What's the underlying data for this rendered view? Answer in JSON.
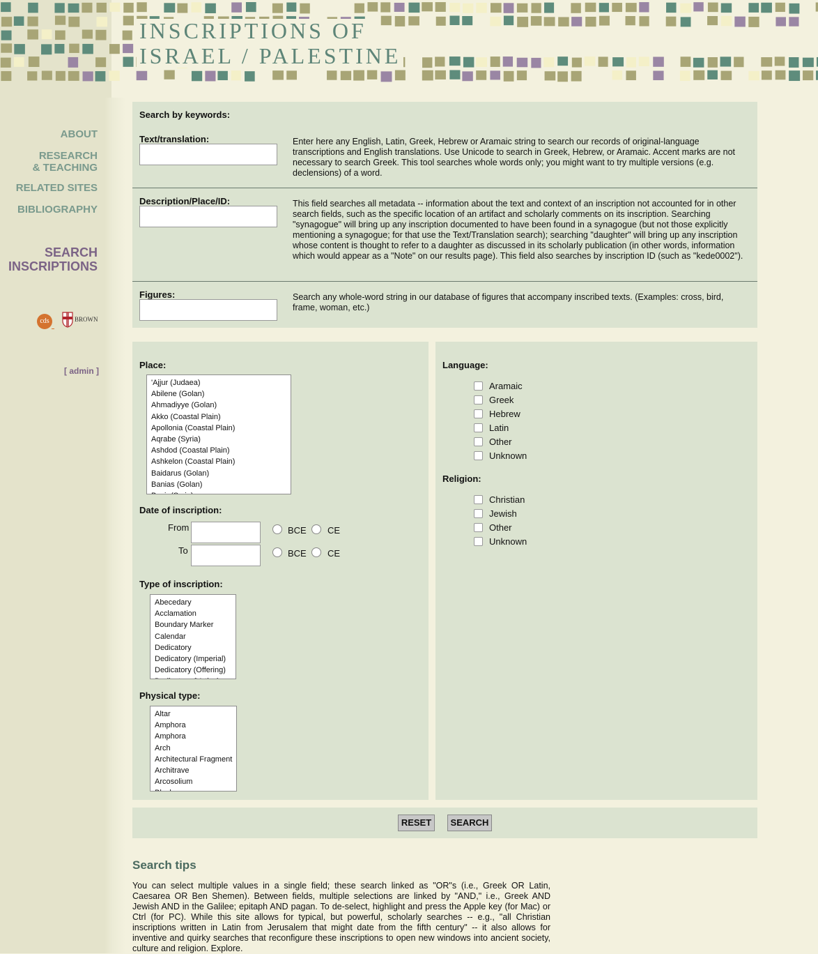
{
  "site": {
    "title_line1": "INSCRIPTIONS OF",
    "title_line2": "ISRAEL / PALESTINE"
  },
  "colors": {
    "mosaic_olive": "#a8a576",
    "mosaic_teal": "#5e8c7c",
    "mosaic_purple": "#9a86a4",
    "mosaic_cream": "#f4f0c8",
    "nav_green": "#7a9a8d",
    "nav_purple": "#7b6386",
    "panel_bg": "#dbe3d0"
  },
  "nav": {
    "about": "ABOUT",
    "research_line1": "RESEARCH",
    "research_line2": "& TEACHING",
    "related": "RELATED SITES",
    "bibliography": "BIBLIOGRAPHY",
    "search_line1": "SEARCH",
    "search_line2": "INSCRIPTIONS",
    "cds_logo": "cds",
    "brown_logo": "BROWN",
    "admin": "[ admin ]"
  },
  "keywords": {
    "heading": "Search by keywords:",
    "text_label": "Text/translation:",
    "text_help": "Enter here any English, Latin, Greek, Hebrew or Aramaic string to search our records of original-language transcriptions and English translations. Use Unicode to search in Greek, Hebrew, or Aramaic. Accent marks are not necessary to search Greek. This tool searches whole words only; you might want to try multiple versions (e.g. declensions) of a word.",
    "desc_label": "Description/Place/ID:",
    "desc_help": "This field searches all metadata -- information about the text and context of an inscription not accounted for in other search fields, such as the specific location of an artifact and scholarly comments on its inscription. Searching \"synagogue\" will bring up any inscription documented to have been found in a synagogue (but not those explicitly mentioning a synagogue; for that use the Text/Translation search); searching \"daughter\" will bring up any inscription whose content is thought to refer to a daughter as discussed in its scholarly publication (in other words, information which would appear as a \"Note\" on our results page). This field also searches by inscription ID (such as \"kede0002\").",
    "figures_label": "Figures:",
    "figures_help": "Search any whole-word string in our database of figures that accompany inscribed texts. (Examples: cross, bird, frame, woman, etc.)"
  },
  "filters": {
    "place_label": "Place:",
    "places": [
      "'Ajjur (Judaea)",
      "Abilene (Golan)",
      "Ahmadiyye (Golan)",
      "Akko (Coastal Plain)",
      "Apollonia (Coastal Plain)",
      "Aqrabe (Syria)",
      "Ashdod (Coastal Plain)",
      "Ashkelon (Coastal Plain)",
      "Baidarus (Golan)",
      "Banias (Golan)",
      "Bosir (Syria)"
    ],
    "date_label": "Date of inscription:",
    "from_label": "From",
    "to_label": "To",
    "bce": "BCE",
    "ce": "CE",
    "type_label": "Type of inscription:",
    "types": [
      "Abecedary",
      "Acclamation",
      "Boundary Marker",
      "Calendar",
      "Dedicatory",
      "Dedicatory (Imperial)",
      "Dedicatory (Offering)",
      "Dedicatory (Votive)"
    ],
    "physical_label": "Physical type:",
    "physical": [
      "Altar",
      "Amphora",
      "Amphora",
      "Arch",
      "Architectural Fragment",
      "Architrave",
      "Arcosolium",
      "Block"
    ],
    "language_label": "Language:",
    "languages": [
      "Aramaic",
      "Greek",
      "Hebrew",
      "Latin",
      "Other",
      "Unknown"
    ],
    "religion_label": "Religion:",
    "religions": [
      "Christian",
      "Jewish",
      "Other",
      "Unknown"
    ]
  },
  "buttons": {
    "reset": "RESET",
    "search": "SEARCH"
  },
  "tips": {
    "title": "Search tips",
    "body": "You can select multiple values in a single field; these search linked as \"OR\"s (i.e., Greek OR Latin, Caesarea OR Ben Shemen). Between fields, multiple selections are linked by \"AND,\" i.e., Greek AND Jewish AND in the Galilee; epitaph AND pagan. To de-select, highlight and press the Apple key (for Mac) or Ctrl (for PC). While this site allows for typical, but powerful, scholarly searches -- e.g., \"all Christian inscriptions written in Latin from Jerusalem that might date from the fifth century\" -- it also allows for inventive and quirky searches that reconfigure these inscriptions to open new windows into ancient society, culture and religion. Explore."
  }
}
